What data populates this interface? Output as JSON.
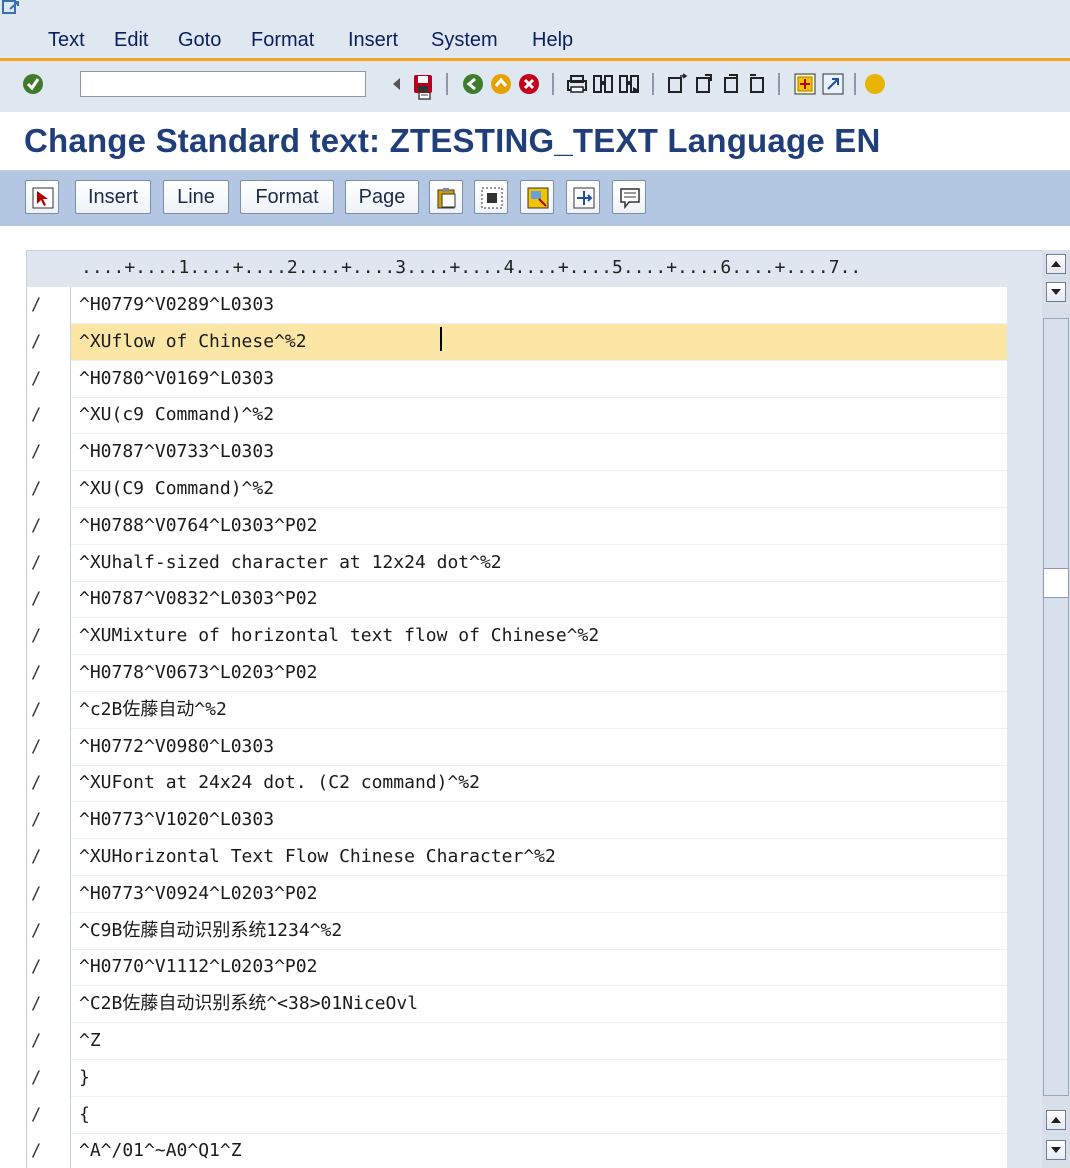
{
  "menu": {
    "items": [
      "Text",
      "Edit",
      "Goto",
      "Format",
      "Insert",
      "System",
      "Help"
    ]
  },
  "system_toolbar": {
    "command_field": {
      "value": "",
      "placeholder": ""
    },
    "icons": [
      "enter-icon",
      "back-arrow-icon",
      "save-icon",
      "back-icon",
      "exit-icon",
      "cancel-icon",
      "print-icon",
      "find-icon",
      "find-next-icon",
      "first-page-icon",
      "previous-page-icon",
      "next-page-icon",
      "last-page-icon",
      "create-session-icon",
      "shortcut-icon",
      "help-icon"
    ]
  },
  "title": "Change Standard text: ZTESTING_TEXT Language EN",
  "app_toolbar": {
    "buttons": [
      "Insert",
      "Line",
      "Format",
      "Page"
    ]
  },
  "editor": {
    "ruler": "....+....1....+....2....+....3....+....4....+....5....+....6....+....7..",
    "lines": [
      {
        "cmd": "/",
        "text": "^H0779^V0289^L0303"
      },
      {
        "cmd": "/",
        "text": "^XUflow of Chinese^%2"
      },
      {
        "cmd": "/",
        "text": "^H0780^V0169^L0303"
      },
      {
        "cmd": "/",
        "text": "^XU(c9 Command)^%2"
      },
      {
        "cmd": "/",
        "text": "^H0787^V0733^L0303"
      },
      {
        "cmd": "/",
        "text": "^XU(C9 Command)^%2"
      },
      {
        "cmd": "/",
        "text": "^H0788^V0764^L0303^P02"
      },
      {
        "cmd": "/",
        "text": "^XUhalf-sized character at 12x24 dot^%2"
      },
      {
        "cmd": "/",
        "text": "^H0787^V0832^L0303^P02"
      },
      {
        "cmd": "/",
        "text": "^XUMixture of horizontal text flow of Chinese^%2"
      },
      {
        "cmd": "/",
        "text": "^H0778^V0673^L0203^P02"
      },
      {
        "cmd": "/",
        "text": "^c2B佐藤自动^%2"
      },
      {
        "cmd": "/",
        "text": "^H0772^V0980^L0303"
      },
      {
        "cmd": "/",
        "text": "^XUFont at 24x24 dot. (C2 command)^%2"
      },
      {
        "cmd": "/",
        "text": "^H0773^V1020^L0303"
      },
      {
        "cmd": "/",
        "text": "^XUHorizontal Text Flow Chinese Character^%2"
      },
      {
        "cmd": "/",
        "text": "^H0773^V0924^L0203^P02"
      },
      {
        "cmd": "/",
        "text": "^C9B佐藤自动识别系统1234^%2"
      },
      {
        "cmd": "/",
        "text": "^H0770^V1112^L0203^P02"
      },
      {
        "cmd": "/",
        "text": "^C2B佐藤自动识别系统^<38>01NiceOvl"
      },
      {
        "cmd": "/",
        "text": "^Z"
      },
      {
        "cmd": "/",
        "text": "}"
      },
      {
        "cmd": "/",
        "text": "{"
      },
      {
        "cmd": "/",
        "text": "^A^/01^~A0^Q1^Z"
      }
    ],
    "active_line": 1
  },
  "colors": {
    "title": "#1f3e7a",
    "active_line": "#fbe6a6",
    "menu_underline": "#f6a21e",
    "toolbar_bg": "#b3c7e2"
  }
}
